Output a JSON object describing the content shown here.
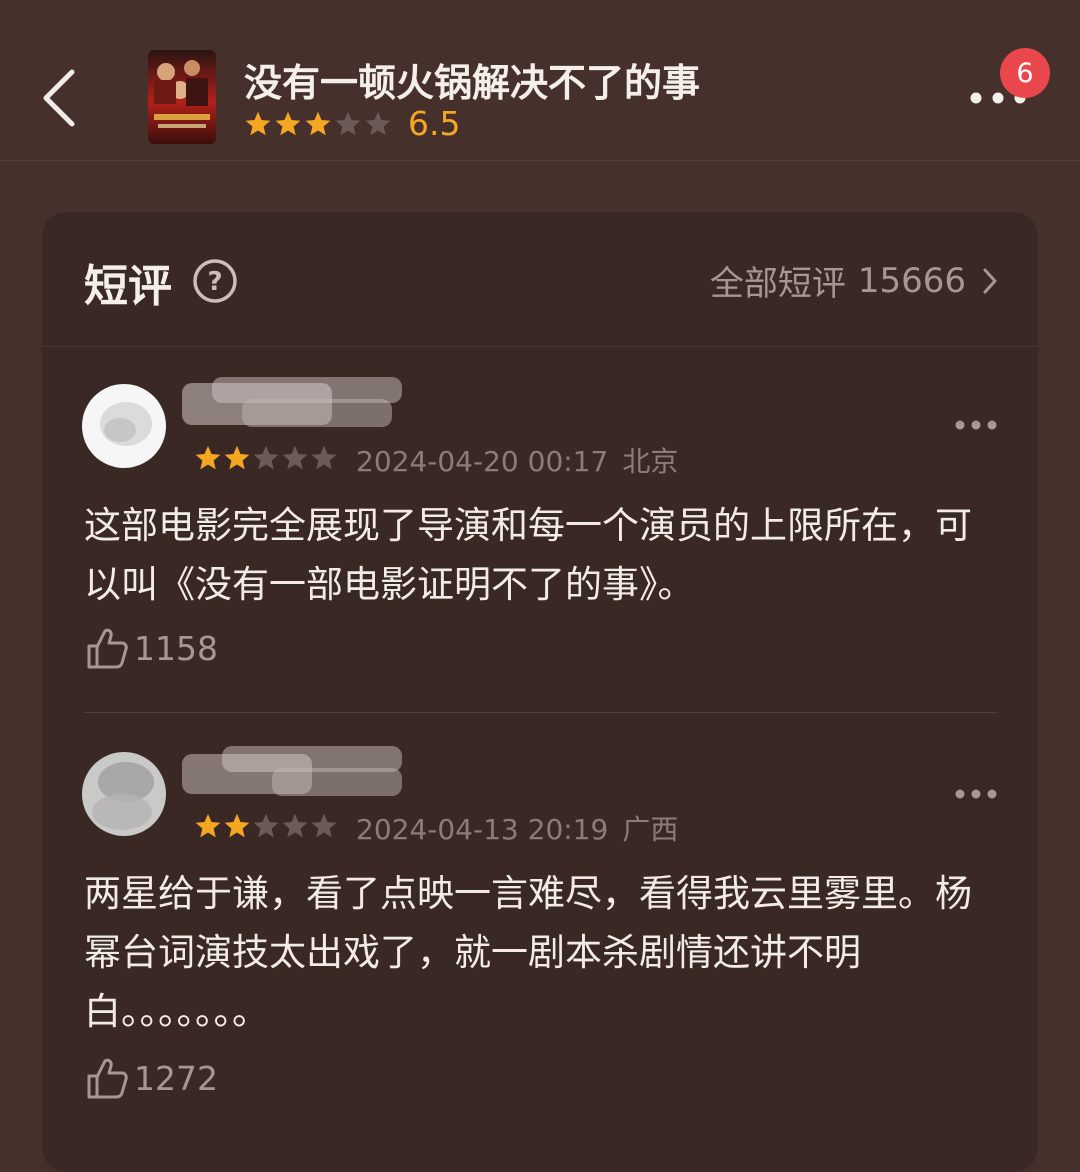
{
  "header": {
    "title": "没有一顿火锅解决不了的事",
    "rating": 6.5,
    "rating_text": "6.5",
    "star_rating": 3,
    "notification_count": "6",
    "back_icon": "chevron-left-icon",
    "more_icon": "more-horizontal-icon"
  },
  "short_reviews": {
    "title": "短评",
    "help_icon": "question-circle-icon",
    "all_label": "全部短评",
    "all_count": "15666",
    "reviews": [
      {
        "stars": 2,
        "date": "2024-04-20 00:17",
        "location": "北京",
        "text": "这部电影完全展现了导演和每一个演员的上限所在，可以叫《没有一部电影证明不了的事》。",
        "likes": "1158"
      },
      {
        "stars": 2,
        "date": "2024-04-13 20:19",
        "location": "广西",
        "text": "两星给于谦，看了点映一言难尽，看得我云里雾里。杨幂台词演技太出戏了，就一剧本杀剧情还讲不明白。。。。。。。",
        "likes": "1272"
      }
    ]
  },
  "colors": {
    "background": "#46302b",
    "card": "#3a2825",
    "star_filled": "#f5a623",
    "star_empty": "#6b5a55",
    "badge": "#e9474c"
  }
}
